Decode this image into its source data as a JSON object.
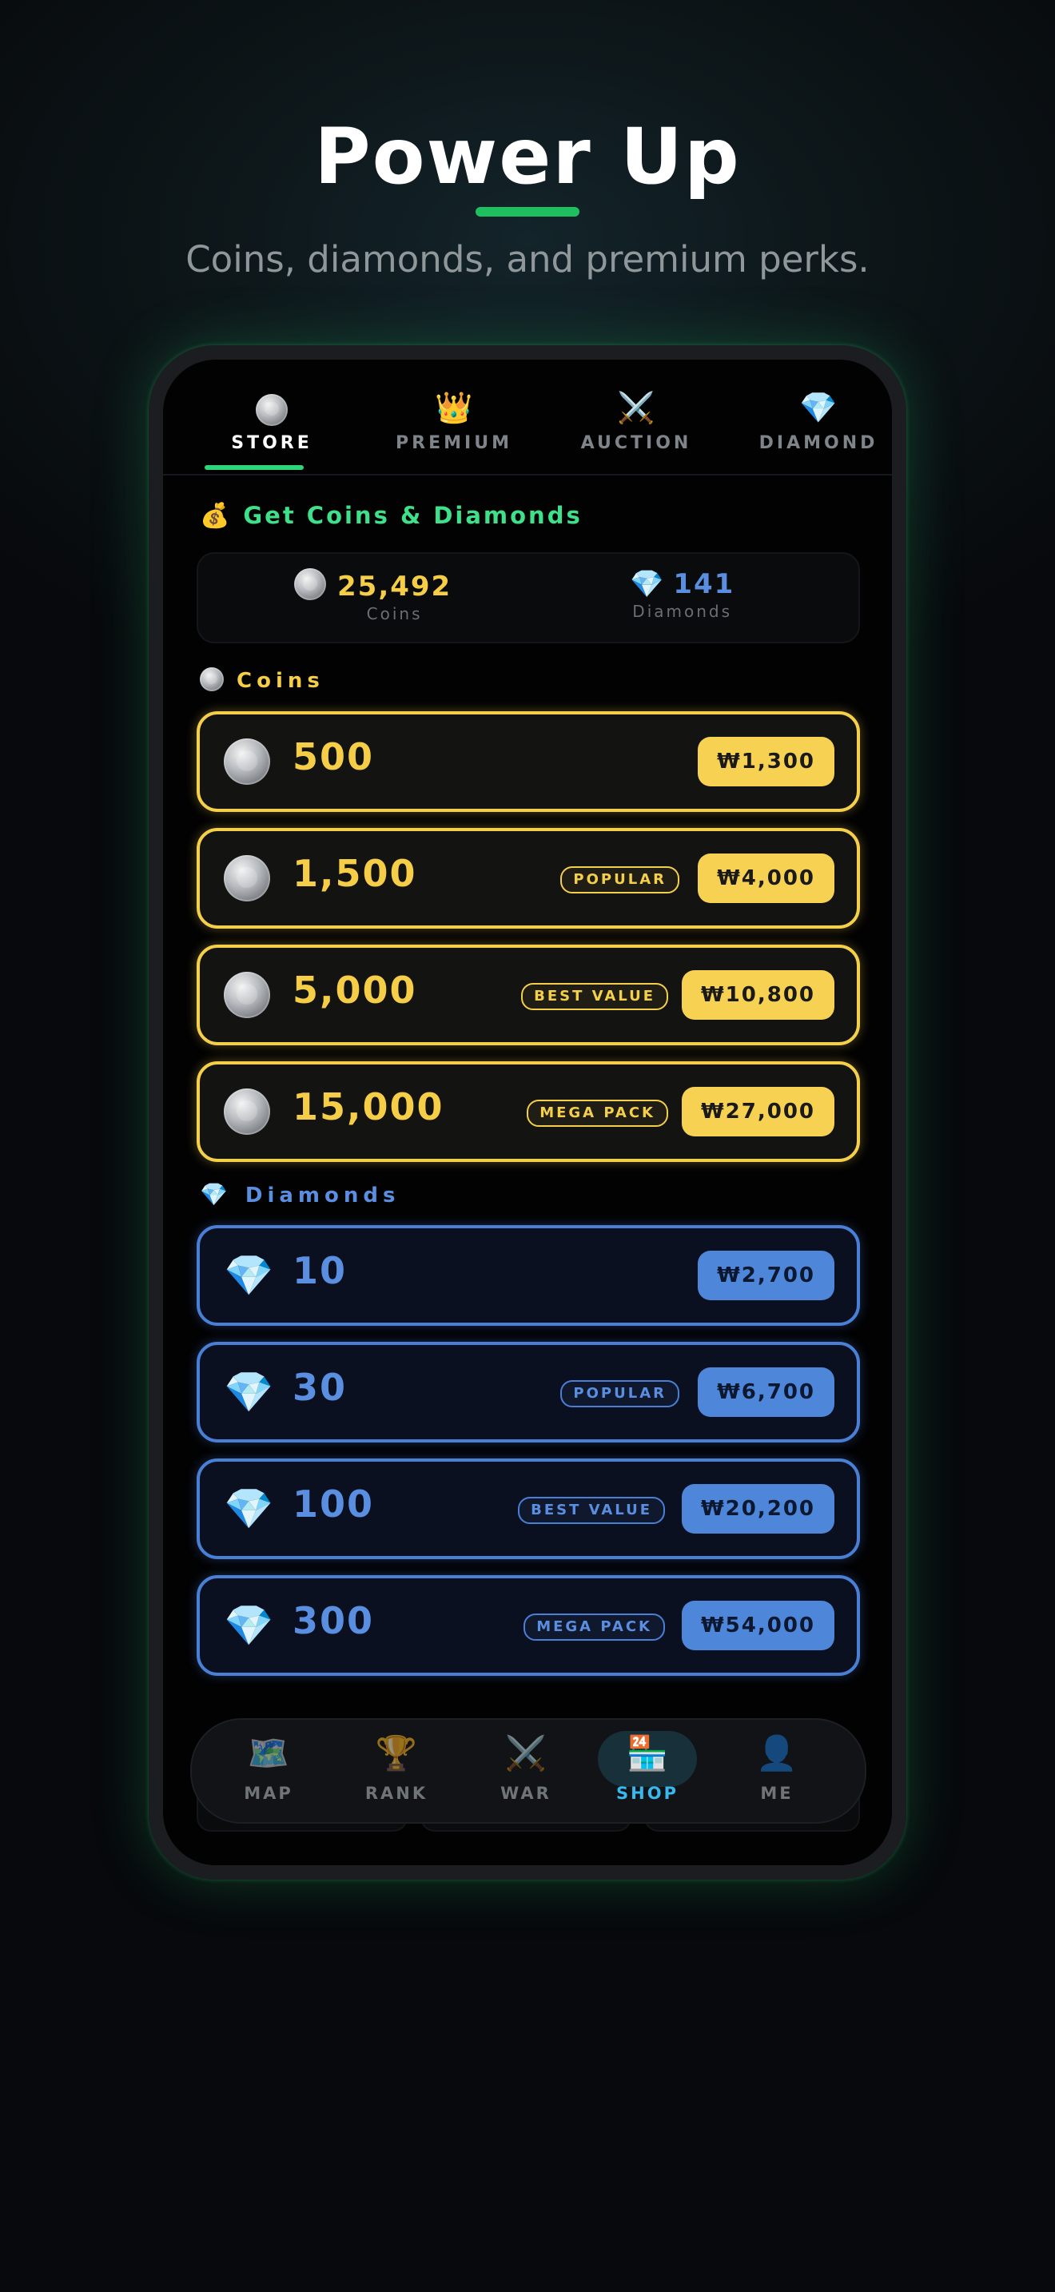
{
  "hero": {
    "title": "Power Up",
    "subtitle": "Coins, diamonds, and premium perks."
  },
  "tabs": [
    {
      "label": "STORE",
      "icon": "coin-icon",
      "active": true
    },
    {
      "label": "PREMIUM",
      "icon": "crown-icon",
      "active": false
    },
    {
      "label": "AUCTION",
      "icon": "crossed-swords-icon",
      "active": false
    },
    {
      "label": "DIAMOND",
      "icon": "diamond-icon",
      "active": false
    }
  ],
  "section": {
    "title": "Get Coins & Diamonds",
    "icon": "money-bag-icon"
  },
  "balance": {
    "coins_value": "25,492",
    "coins_label": "Coins",
    "diamonds_value": "141",
    "diamonds_label": "Diamonds"
  },
  "coins_group": {
    "label": "Coins",
    "packs": [
      {
        "amount": "500",
        "badge": "",
        "price": "₩1,300"
      },
      {
        "amount": "1,500",
        "badge": "POPULAR",
        "price": "₩4,000"
      },
      {
        "amount": "5,000",
        "badge": "BEST VALUE",
        "price": "₩10,800"
      },
      {
        "amount": "15,000",
        "badge": "MEGA PACK",
        "price": "₩27,000"
      }
    ]
  },
  "diamonds_group": {
    "label": "Diamonds",
    "packs": [
      {
        "amount": "10",
        "badge": "",
        "price": "₩2,700"
      },
      {
        "amount": "30",
        "badge": "POPULAR",
        "price": "₩6,700"
      },
      {
        "amount": "100",
        "badge": "BEST VALUE",
        "price": "₩20,200"
      },
      {
        "amount": "300",
        "badge": "MEGA PACK",
        "price": "₩54,000"
      }
    ]
  },
  "bottom_nav": [
    {
      "label": "MAP",
      "icon": "map-icon",
      "active": false
    },
    {
      "label": "RANK",
      "icon": "trophy-icon",
      "active": false
    },
    {
      "label": "WAR",
      "icon": "crossed-swords-icon",
      "active": false
    },
    {
      "label": "SHOP",
      "icon": "convenience-store-icon",
      "active": true
    },
    {
      "label": "ME",
      "icon": "profile-icon",
      "active": false
    }
  ],
  "colors": {
    "accent_green": "#2ed47a",
    "coin_gold": "#f5cd47",
    "diamond_blue": "#4e86da",
    "nav_active": "#37b8f0"
  }
}
